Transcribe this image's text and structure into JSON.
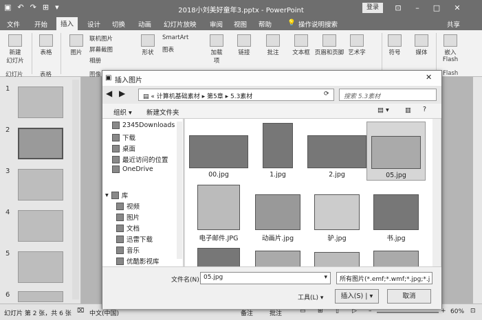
{
  "window": {
    "title": "2018小刘美好童年3.pptx - PowerPoint",
    "login": "登录"
  },
  "tabs": [
    "文件",
    "开始",
    "插入",
    "设计",
    "切换",
    "动画",
    "幻灯片放映",
    "审阅",
    "视图",
    "帮助",
    "操作说明搜索"
  ],
  "share": "共享",
  "ribbon": {
    "new_slide": "新建\n幻灯片",
    "table": "表格",
    "pictures": "图片",
    "online_pic": "联机图片",
    "screenshot": "屏幕截图",
    "album": "相册",
    "shapes": "形状",
    "smartart": "SmartArt",
    "chart": "图表",
    "addins": "加载\n项",
    "link": "链接",
    "comment": "批注",
    "textbox": "文本框",
    "header_footer": "页眉和页脚",
    "wordart": "艺术字",
    "symbol": "符号",
    "media": "媒体",
    "flash": "嵌入\nFlash",
    "groups": {
      "slides": "幻灯片",
      "tables": "表格",
      "images": "图像",
      "flash": "Flash"
    }
  },
  "slides": [
    "1",
    "2",
    "3",
    "4",
    "5",
    "6"
  ],
  "dialog": {
    "title": "插入图片",
    "breadcrumb": [
      "计算机基础素材",
      "第5章",
      "5.3素材"
    ],
    "search_placeholder": "搜索 5.3素材",
    "organize": "组织",
    "new_folder": "新建文件夹",
    "nav": [
      "2345Downloads",
      "下载",
      "桌面",
      "最近访问的位置",
      "OneDrive",
      "库",
      "视频",
      "图片",
      "文档",
      "迅雷下载",
      "音乐",
      "优酷影视库"
    ],
    "files": [
      "00.jpg",
      "1.jpg",
      "2.jpg",
      "05.jpg",
      "电子邮件.JPG",
      "动画片.jpg",
      "驴.jpg",
      "书.jpg"
    ],
    "filename_label": "文件名(N):",
    "filename_value": "05.jpg",
    "filetype": "所有图片(*.emf;*.wmf;*.jpg;*.j",
    "tools": "工具(L)",
    "insert": "插入(S)",
    "cancel": "取消"
  },
  "status": {
    "slide_info": "幻灯片 第 2 张，共 6 张",
    "lang": "中文(中国)",
    "notes": "备注",
    "comments": "批注",
    "zoom": "60%"
  }
}
